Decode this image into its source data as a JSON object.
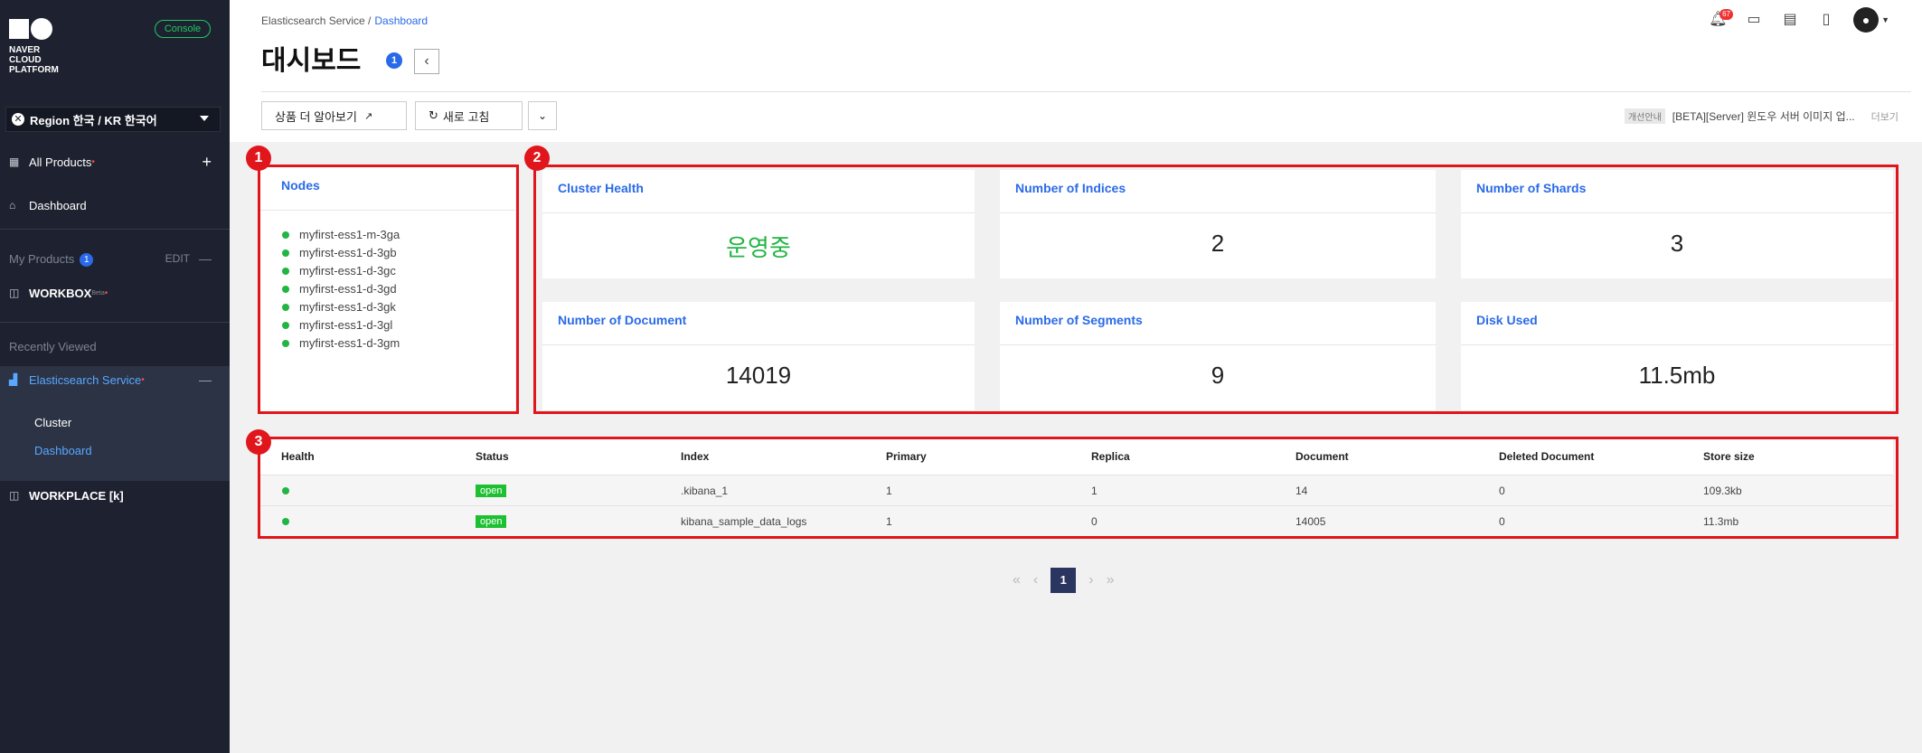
{
  "sidebar": {
    "logo_text": "NAVER\nCLOUD PLATFORM",
    "console_label": "Console",
    "region_label": "Region 한국 / KR 한국어",
    "all_products": "All Products",
    "dashboard": "Dashboard",
    "my_products": "My Products",
    "my_products_count": "1",
    "edit": "EDIT",
    "workbox": "WORKBOX",
    "workbox_sup": "Beta",
    "recently_viewed": "Recently Viewed",
    "es_service": "Elasticsearch Service",
    "cluster": "Cluster",
    "es_dashboard": "Dashboard",
    "workplace": "WORKPLACE [k]"
  },
  "header": {
    "breadcrumb_root": "Elasticsearch Service /",
    "breadcrumb_current": "Dashboard",
    "title": "대시보드",
    "title_badge": "1",
    "notif_count": "67",
    "btn_learn_more": "상품 더 알아보기",
    "btn_refresh": "새로 고침",
    "notice_tag": "개선안내",
    "notice_text": "[BETA][Server] 윈도우 서버 이미지 업...",
    "notice_more": "더보기"
  },
  "annotations": [
    "1",
    "2",
    "3"
  ],
  "nodes": {
    "title": "Nodes",
    "items": [
      "myfirst-ess1-m-3ga",
      "myfirst-ess1-d-3gb",
      "myfirst-ess1-d-3gc",
      "myfirst-ess1-d-3gd",
      "myfirst-ess1-d-3gk",
      "myfirst-ess1-d-3gl",
      "myfirst-ess1-d-3gm"
    ]
  },
  "stats": [
    {
      "title": "Cluster Health",
      "value": "운영중"
    },
    {
      "title": "Number of Indices",
      "value": "2"
    },
    {
      "title": "Number of Shards",
      "value": "3"
    },
    {
      "title": "Number of Document",
      "value": "14019"
    },
    {
      "title": "Number of Segments",
      "value": "9"
    },
    {
      "title": "Disk Used",
      "value": "11.5mb"
    }
  ],
  "table": {
    "headers": [
      "Health",
      "Status",
      "Index",
      "Primary",
      "Replica",
      "Document",
      "Deleted Document",
      "Store size"
    ],
    "rows": [
      {
        "status": "open",
        "index": ".kibana_1",
        "primary": "1",
        "replica": "1",
        "document": "14",
        "deleted": "0",
        "size": "109.3kb"
      },
      {
        "status": "open",
        "index": "kibana_sample_data_logs",
        "primary": "1",
        "replica": "0",
        "document": "14005",
        "deleted": "0",
        "size": "11.3mb"
      }
    ]
  },
  "pagination": {
    "current": "1"
  },
  "colors": {
    "accent_blue": "#2a6ae8",
    "healthy_green": "#22b543",
    "annotation_red": "#e0161c",
    "sidebar_bg": "#1e2230"
  }
}
